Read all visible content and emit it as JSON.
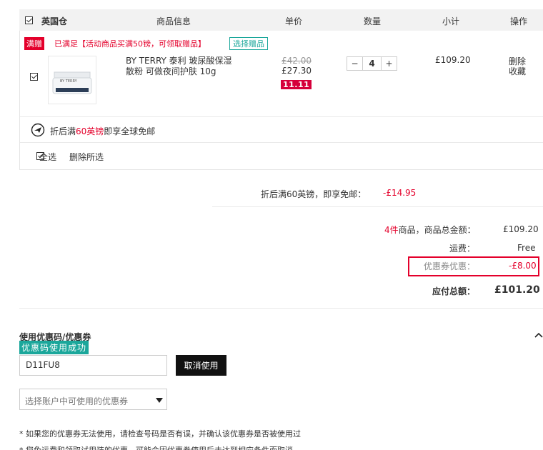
{
  "header": {
    "warehouse": "英国仓",
    "col_product": "商品信息",
    "col_price": "单价",
    "col_qty": "数量",
    "col_subtotal": "小计",
    "col_action": "操作"
  },
  "promo": {
    "tag": "满赠",
    "text": "已满足【活动商品买满50镑，可领取赠品】",
    "gift_button": "选择赠品"
  },
  "item": {
    "name": "BY TERRY 泰利 玻尿酸保湿散粉 可做夜间护肤 10g",
    "thumb_brand": "BY TERRY",
    "original_price": "£42.00",
    "price": "£27.30",
    "badge": "11.11",
    "qty": "4",
    "qty_minus": "−",
    "qty_plus": "+",
    "subtotal": "£109.20",
    "action_delete": "删除",
    "action_favorite": "收藏"
  },
  "shipping_notice": {
    "prefix": "折后满",
    "highlight": "60英镑",
    "suffix": "即享全球免邮"
  },
  "bulk": {
    "select_all": "全选",
    "delete_selected": "删除所选"
  },
  "free_ship_line": {
    "label": "折后满60英镑，即享免邮：",
    "value": "-£14.95"
  },
  "summary": {
    "count": "4件",
    "count_label": "商品，商品总金额：",
    "goods_total": "£109.20",
    "shipping_label": "运费：",
    "shipping_value": "Free",
    "coupon_label": "优惠券优惠：",
    "coupon_value": "-£8.00",
    "total_label": "应付总额：",
    "total_value": "£101.20"
  },
  "coupon": {
    "title": "使用优惠码/优惠券",
    "success": "优惠码使用成功",
    "code_value": "D11FU8",
    "cancel_button": "取消使用",
    "select_placeholder": "选择账户中可使用的优惠券",
    "note1": "* 如果您的优惠券无法使用，请检查号码是否有误，并确认该优惠券是否被使用过",
    "note2": "* 您免运费和领取试用装的优惠，可能会因优惠券使用后未达到相应条件而取消"
  },
  "colors": {
    "accent_red": "#e4002b",
    "teal": "#1ba79b",
    "badge_red": "#d6003b"
  }
}
